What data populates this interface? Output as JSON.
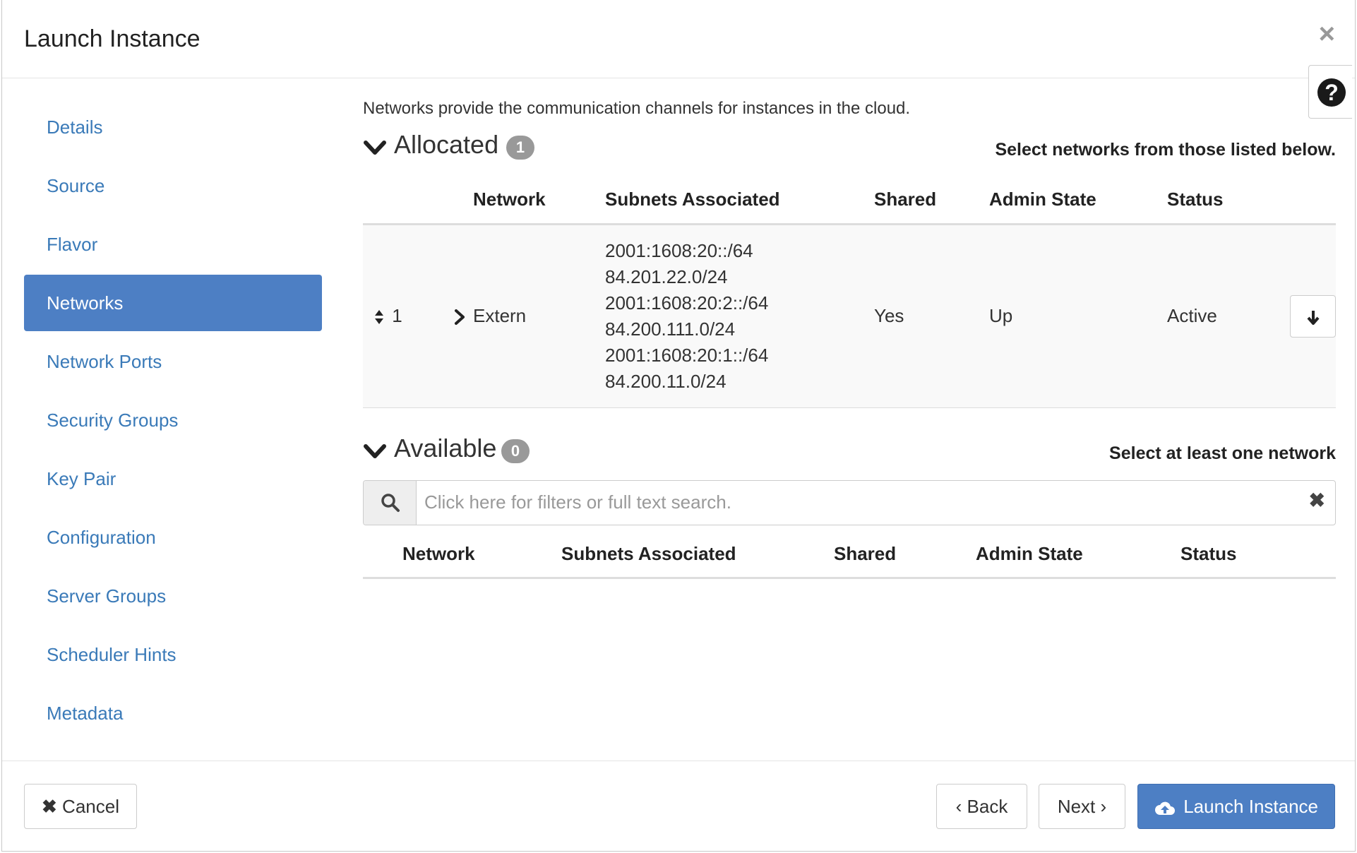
{
  "modal": {
    "title": "Launch Instance",
    "close_icon": "×",
    "help_icon": "?"
  },
  "sidebar": {
    "items": [
      {
        "label": "Details"
      },
      {
        "label": "Source"
      },
      {
        "label": "Flavor"
      },
      {
        "label": "Networks",
        "active": true
      },
      {
        "label": "Network Ports"
      },
      {
        "label": "Security Groups"
      },
      {
        "label": "Key Pair"
      },
      {
        "label": "Configuration"
      },
      {
        "label": "Server Groups"
      },
      {
        "label": "Scheduler Hints"
      },
      {
        "label": "Metadata"
      }
    ]
  },
  "networks": {
    "intro": "Networks provide the communication channels for instances in the cloud.",
    "allocated": {
      "title": "Allocated",
      "count": "1",
      "help": "Select networks from those listed below.",
      "columns": [
        "Network",
        "Subnets Associated",
        "Shared",
        "Admin State",
        "Status"
      ],
      "row": {
        "order": "1",
        "network": "Extern",
        "subnets": [
          "2001:1608:20::/64",
          "84.201.22.0/24",
          "2001:1608:20:2::/64",
          "84.200.111.0/24",
          "2001:1608:20:1::/64",
          "84.200.11.0/24"
        ],
        "shared": "Yes",
        "admin_state": "Up",
        "status": "Active"
      }
    },
    "available": {
      "title": "Available",
      "count": "0",
      "help": "Select at least one network",
      "search_placeholder": "Click here for filters or full text search.",
      "columns": [
        "Network",
        "Subnets Associated",
        "Shared",
        "Admin State",
        "Status"
      ]
    }
  },
  "footer": {
    "cancel": "Cancel",
    "back": "Back",
    "next": "Next",
    "launch": "Launch Instance"
  },
  "colors": {
    "primary": "#4d7fc4",
    "link": "#3a7ab8",
    "badge": "#999999"
  }
}
